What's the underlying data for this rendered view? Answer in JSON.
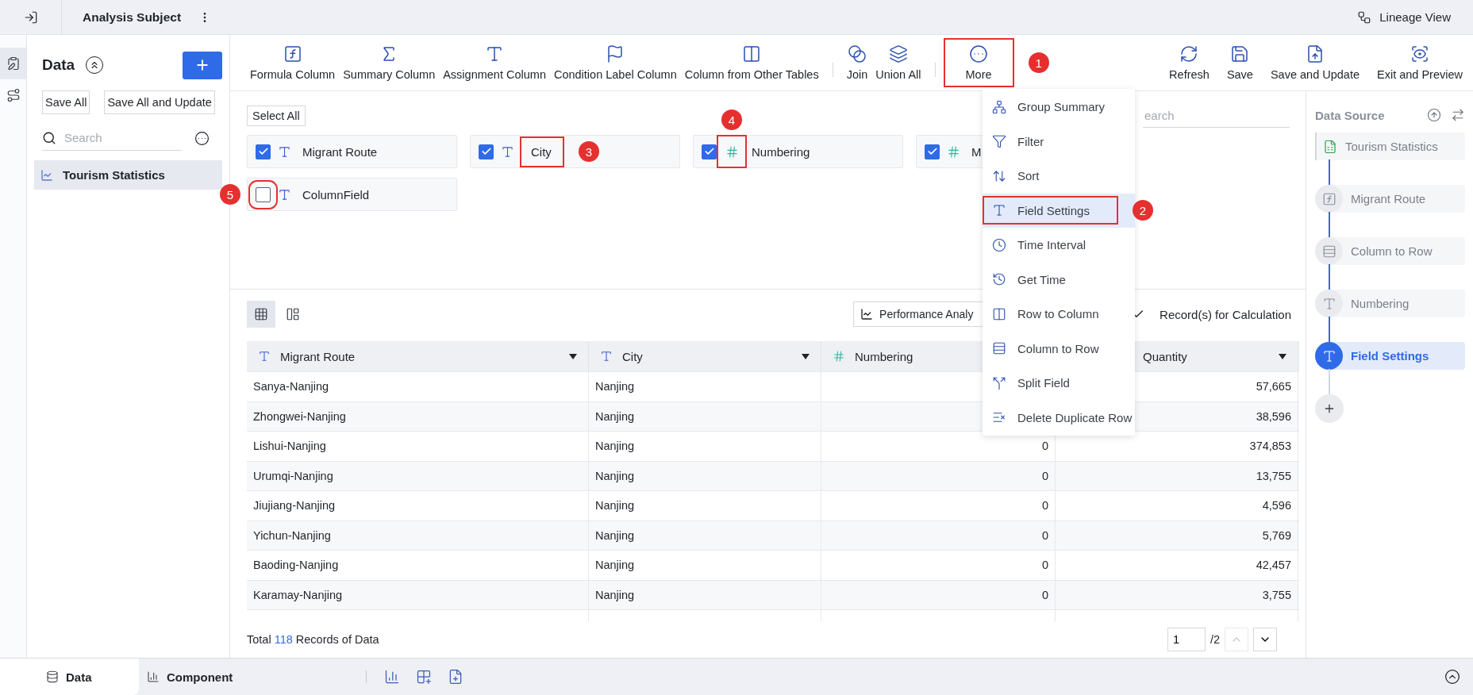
{
  "topbar": {
    "title": "Analysis Subject",
    "lineage": "Lineage View"
  },
  "rail": [
    {
      "selected": true
    },
    {
      "selected": false
    }
  ],
  "data_panel": {
    "title": "Data",
    "buttons": [
      "Save All",
      "Save All and Update"
    ],
    "search": {
      "placeholder": "Search"
    },
    "items": [
      {
        "label": "Tourism Statistics",
        "selected": true
      }
    ]
  },
  "toolbar": {
    "groups": [
      [
        {
          "label": "Formula Column"
        },
        {
          "label": "Summary Column"
        },
        {
          "label": "Assignment Column"
        },
        {
          "label": "Condition Label Column"
        },
        {
          "label": "Column from Other Tables"
        }
      ],
      [
        {
          "label": "Join"
        },
        {
          "label": "Union All"
        }
      ],
      [
        {
          "label": "More",
          "callout": "1"
        }
      ]
    ],
    "actions": [
      {
        "label": "Refresh"
      },
      {
        "label": "Save"
      },
      {
        "label": "Save and Update"
      },
      {
        "label": "Exit and Preview"
      }
    ]
  },
  "fields_panel": {
    "select_all": "Select All",
    "search": {
      "placeholder": "earch"
    },
    "fields": [
      {
        "label": "Migrant Route",
        "kind": "text",
        "checked": true
      },
      {
        "label": "City",
        "kind": "text",
        "checked": true,
        "callout": "3"
      },
      {
        "label": "Numbering",
        "kind": "number",
        "checked": true,
        "callout": "4"
      },
      {
        "label": "M",
        "kind": "number",
        "checked": true
      },
      {
        "label": "ColumnField",
        "kind": "text",
        "checked": false,
        "callout": "5"
      }
    ]
  },
  "menu": {
    "items": [
      {
        "label": "Group Summary",
        "selected": false
      },
      {
        "label": "Filter",
        "selected": false
      },
      {
        "label": "Sort",
        "selected": false
      },
      {
        "label": "Field Settings",
        "selected": true,
        "callout": "2"
      },
      {
        "label": "Time Interval",
        "selected": false
      },
      {
        "label": "Get Time",
        "selected": false
      },
      {
        "label": "Row to Column",
        "selected": false
      },
      {
        "label": "Column to Row",
        "selected": false
      },
      {
        "label": "Split Field",
        "selected": false
      },
      {
        "label": "Delete Duplicate Row",
        "selected": false
      }
    ]
  },
  "table": {
    "view_modes": [
      {
        "selected": true
      },
      {
        "selected": false
      }
    ],
    "analysis_button": "Performance Analy",
    "records": {
      "checked": true,
      "label": "Record(s) for Calculation"
    },
    "columns": [
      {
        "label": "Migrant Route",
        "kind": "text"
      },
      {
        "label": "City",
        "kind": "text"
      },
      {
        "label": "Numbering",
        "kind": "number"
      },
      {
        "label": "Quantity"
      }
    ],
    "rows": [
      {
        "route": "Sanya-Nanjing",
        "city": "Nanjing",
        "quantity": "57,665"
      },
      {
        "route": "Zhongwei-Nanjing",
        "city": "Nanjing",
        "quantity": "38,596"
      },
      {
        "route": "Lishui-Nanjing",
        "city": "Nanjing",
        "numbering": "0",
        "quantity": "374,853"
      },
      {
        "route": "Urumqi-Nanjing",
        "city": "Nanjing",
        "numbering": "0",
        "quantity": "13,755"
      },
      {
        "route": "Jiujiang-Nanjing",
        "city": "Nanjing",
        "numbering": "0",
        "quantity": "4,596"
      },
      {
        "route": "Yichun-Nanjing",
        "city": "Nanjing",
        "numbering": "0",
        "quantity": "5,769"
      },
      {
        "route": "Baoding-Nanjing",
        "city": "Nanjing",
        "numbering": "0",
        "quantity": "42,457"
      },
      {
        "route": "Karamay-Nanjing",
        "city": "Nanjing",
        "numbering": "0",
        "quantity": "3,755"
      }
    ],
    "footer": {
      "prefix": "Total",
      "count": "118",
      "suffix": "Records of Data"
    },
    "pagination": {
      "page": "1",
      "total": "/2"
    }
  },
  "flow": {
    "title": "Data Source",
    "steps": [
      {
        "label": "Tourism Statistics",
        "selected": false
      },
      {
        "label": "Migrant Route",
        "selected": false
      },
      {
        "label": "Column to Row",
        "selected": false
      },
      {
        "label": "Numbering",
        "selected": false
      },
      {
        "label": "Field Settings",
        "selected": true
      }
    ]
  },
  "bottom_tabs": [
    {
      "label": "Data",
      "selected": true
    },
    {
      "label": "Component",
      "selected": false
    }
  ]
}
